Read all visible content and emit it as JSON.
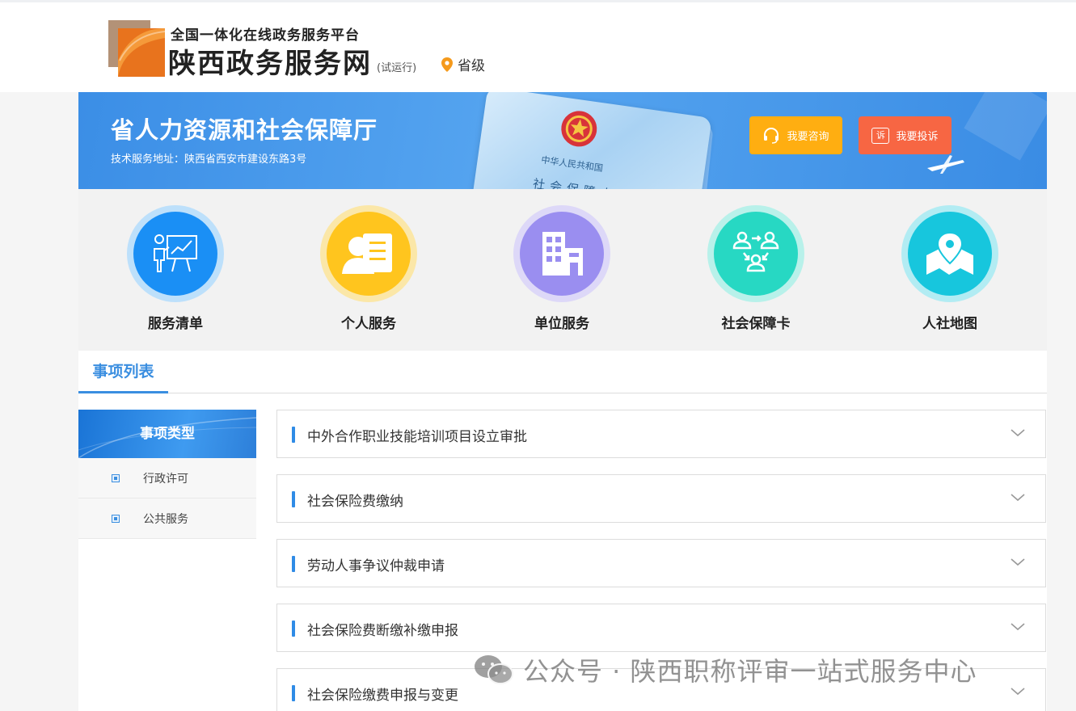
{
  "header": {
    "platform_subtitle": "全国一体化在线政务服务平台",
    "site_name": "陕西政务服务网",
    "trial_tag": "(试运行)",
    "region_label": "省级"
  },
  "banner": {
    "title": "省人力资源和社会保障厅",
    "address": "技术服务地址：陕西省西安市建设东路3号",
    "card_text_country": "中华人民共和国",
    "card_text_name": "社会保障卡",
    "consult_label": "我要咨询",
    "complain_label": "我要投诉",
    "complain_icon_char": "诉"
  },
  "services": [
    {
      "label": "服务清单",
      "icon": "presentation-chart-icon",
      "color": "#1a8ff5",
      "ring": "#bde0fb"
    },
    {
      "label": "个人服务",
      "icon": "id-card-person-icon",
      "color": "#ffc51e",
      "ring": "#fbe7a8"
    },
    {
      "label": "单位服务",
      "icon": "building-icon",
      "color": "#9a8ef0",
      "ring": "#ddd8f8"
    },
    {
      "label": "社会保障卡",
      "icon": "people-exchange-icon",
      "color": "#27d8c3",
      "ring": "#b8f1ea"
    },
    {
      "label": "人社地图",
      "icon": "map-pin-icon",
      "color": "#17c6dd",
      "ring": "#b2ecf3"
    }
  ],
  "list": {
    "tab_label": "事项列表",
    "type_header": "事项类型",
    "types": [
      "行政许可",
      "公共服务"
    ],
    "items": [
      "中外合作职业技能培训项目设立审批",
      "社会保险费缴纳",
      "劳动人事争议仲裁申请",
      "社会保险费断缴补缴申报",
      "社会保险缴费申报与变更"
    ]
  },
  "watermark": {
    "text": "公众号 · 陕西职称评审一站式服务中心",
    "icon": "wechat-icon"
  },
  "colors": {
    "accent": "#3a8ee0",
    "consult": "#ffae11",
    "complain": "#f76643"
  }
}
